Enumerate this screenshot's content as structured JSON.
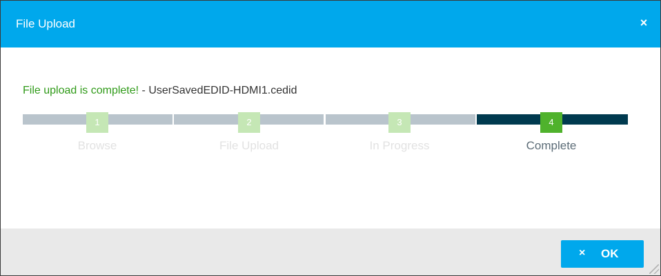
{
  "dialog": {
    "title": "File Upload",
    "close_icon": "×"
  },
  "message": {
    "status": "File upload is complete!",
    "separator": " - ",
    "filename": "UserSavedEDID-HDMI1.cedid"
  },
  "steps": [
    {
      "number": "1",
      "label": "Browse",
      "active": false
    },
    {
      "number": "2",
      "label": "File Upload",
      "active": false
    },
    {
      "number": "3",
      "label": "In Progress",
      "active": false
    },
    {
      "number": "4",
      "label": "Complete",
      "active": true
    }
  ],
  "footer": {
    "ok_icon": "×",
    "ok_label": "OK"
  },
  "colors": {
    "header": "#00a8ec",
    "success_text": "#2f9a18",
    "step_active_bar": "#003a4f",
    "step_active_badge": "#4fb22c",
    "step_inactive_badge": "#c5e7b5"
  }
}
